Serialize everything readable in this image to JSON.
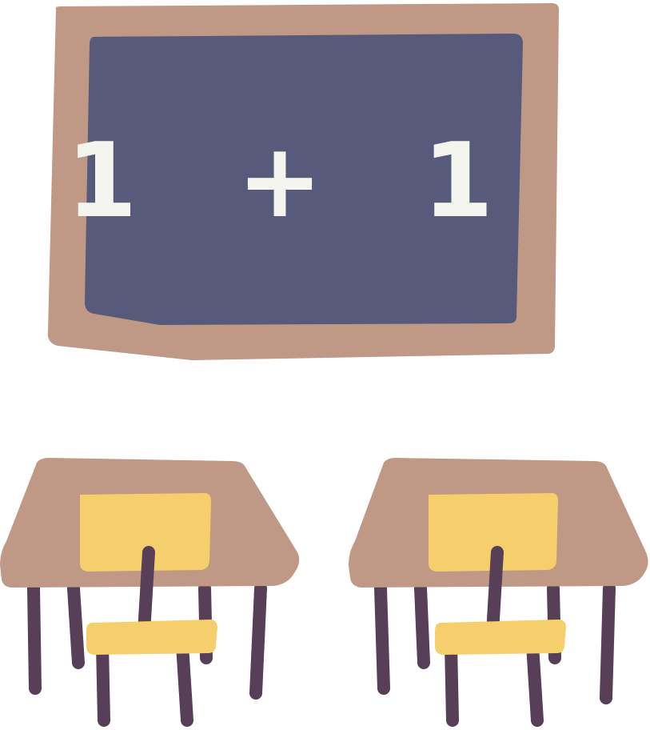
{
  "chalkboard": {
    "equation": "1 + 1"
  },
  "colors": {
    "frame": "#c09886",
    "board": "#575a7a",
    "chalk": "#f5f5ef",
    "desk_top": "#c09886",
    "legs": "#563f57",
    "seat": "#f5cf6c"
  }
}
